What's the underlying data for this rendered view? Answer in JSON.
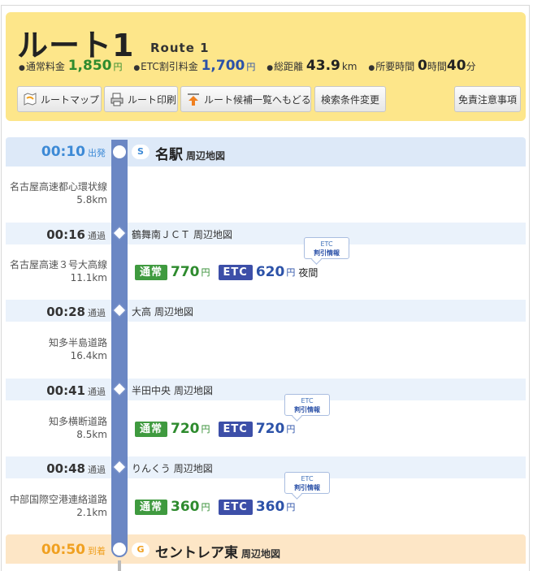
{
  "header": {
    "title": "ルート1",
    "subtitle": "Route 1",
    "stats": [
      {
        "label": "通常料金",
        "value": "1,850",
        "unit": "円"
      },
      {
        "label": "ETC割引料金",
        "value": "1,700",
        "unit": "円"
      },
      {
        "label": "総距離",
        "value": "43.9",
        "unit": "km"
      },
      {
        "label": "所要時間",
        "hours": "0",
        "hours_unit": "時間",
        "minutes": "40",
        "minutes_unit": "分"
      }
    ],
    "buttons": {
      "route_map": "ルートマップ",
      "route_print": "ルート印刷",
      "back_to_list": "ルート候補一覧へもどる",
      "change_conditions": "検索条件変更",
      "disclaimer": "免責注意事項"
    }
  },
  "common": {
    "map_link": "周辺地図",
    "label_normal": "通常",
    "label_etc": "ETC",
    "yen": "円",
    "bubble_line1": "ETC",
    "bubble_line2": "割引情報"
  },
  "start": {
    "time": "00:10",
    "label": "出発",
    "badge": "S",
    "name": "名駅"
  },
  "end": {
    "time": "00:50",
    "label": "到着",
    "badge": "G",
    "name": "セントレア東"
  },
  "passes": [
    {
      "time": "00:16",
      "label": "通過",
      "name": "鶴舞南ＪＣＴ"
    },
    {
      "time": "00:28",
      "label": "通過",
      "name": "大高"
    },
    {
      "time": "00:41",
      "label": "通過",
      "name": "半田中央"
    },
    {
      "time": "00:48",
      "label": "通過",
      "name": "りんくう"
    }
  ],
  "roads": [
    {
      "name": "名古屋高速都心環状線",
      "distance": "5.8km"
    },
    {
      "name": "名古屋高速３号大高線",
      "distance": "11.1km",
      "normal": "770",
      "etc": "620",
      "note": "夜間"
    },
    {
      "name": "知多半島道路",
      "distance": "16.4km"
    },
    {
      "name": "知多横断道路",
      "distance": "8.5km",
      "normal": "720",
      "etc": "720"
    },
    {
      "name": "中部国際空港連絡道路",
      "distance": "2.1km",
      "normal": "360",
      "etc": "360"
    }
  ]
}
